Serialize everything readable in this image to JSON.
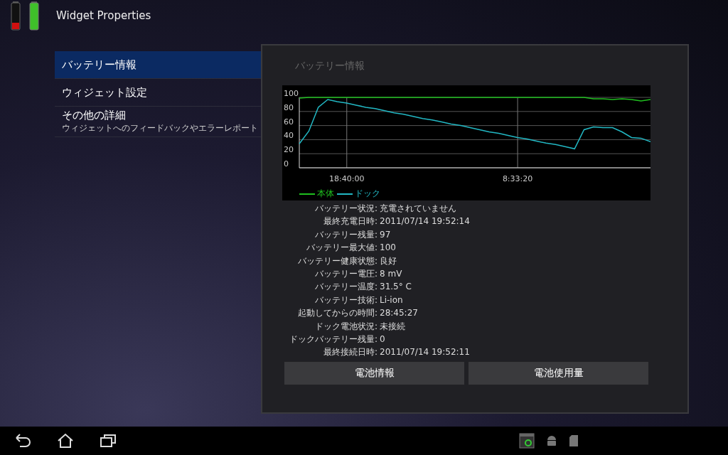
{
  "title_bar": {
    "title": "Widget Properties"
  },
  "sidebar": {
    "items": [
      {
        "title": "バッテリー情報",
        "selected": true
      },
      {
        "title": "ウィジェット設定",
        "selected": false
      },
      {
        "title": "その他の詳細",
        "subtitle": "ウィジェットへのフィードバックやエラーレポート",
        "selected": false
      }
    ]
  },
  "panel": {
    "heading": "バッテリー情報",
    "chart_data": {
      "type": "line",
      "categories": [
        null,
        null,
        null,
        null,
        null,
        "18:40:00",
        null,
        null,
        null,
        null,
        null,
        null,
        null,
        null,
        null,
        null,
        null,
        null,
        null,
        null,
        null,
        null,
        null,
        "8:33:20",
        null,
        null,
        null,
        null,
        null,
        null,
        null,
        null,
        null,
        null,
        null,
        null,
        null,
        null
      ],
      "ylim": [
        0,
        100
      ],
      "yticks": [
        0,
        20,
        40,
        60,
        80,
        100
      ],
      "grid": true,
      "legend": "bottom",
      "series": [
        {
          "name": "本体",
          "color": "#1fbf1f",
          "values": [
            99,
            100,
            100,
            100,
            100,
            100,
            100,
            100,
            100,
            100,
            100,
            100,
            100,
            100,
            100,
            100,
            100,
            100,
            100,
            100,
            100,
            100,
            100,
            100,
            100,
            100,
            100,
            100,
            100,
            100,
            100,
            98,
            98,
            97,
            98,
            97,
            95,
            97
          ]
        },
        {
          "name": "ドック",
          "color": "#22b8c4",
          "values": [
            34,
            52,
            86,
            97,
            94,
            92,
            89,
            86,
            84,
            81,
            78,
            76,
            73,
            70,
            68,
            65,
            62,
            60,
            57,
            54,
            51,
            49,
            46,
            43,
            41,
            38,
            35,
            33,
            30,
            27,
            54,
            58,
            57,
            57,
            51,
            43,
            42,
            37
          ]
        }
      ]
    },
    "info": [
      {
        "label": "バッテリー状況:",
        "value": "充電されていません"
      },
      {
        "label": "最終充電日時:",
        "value": "2011/07/14 19:52:14"
      },
      {
        "label": "バッテリー残量:",
        "value": "97"
      },
      {
        "label": "バッテリー最大値:",
        "value": "100"
      },
      {
        "label": "バッテリー健康状態:",
        "value": "良好"
      },
      {
        "label": "バッテリー電圧:",
        "value": "8 mV"
      },
      {
        "label": "バッテリー温度:",
        "value": "31.5° C"
      },
      {
        "label": "バッテリー技術:",
        "value": "Li-ion"
      },
      {
        "label": "起動してからの時間:",
        "value": "28:45:27"
      },
      {
        "label": "ドック電池状況:",
        "value": "未接続"
      },
      {
        "label": "ドックバッテリー残量:",
        "value": "0"
      },
      {
        "label": "最終接続日時:",
        "value": "2011/07/14 19:52:11"
      }
    ],
    "buttons": [
      "電池情報",
      "電池使用量"
    ]
  }
}
